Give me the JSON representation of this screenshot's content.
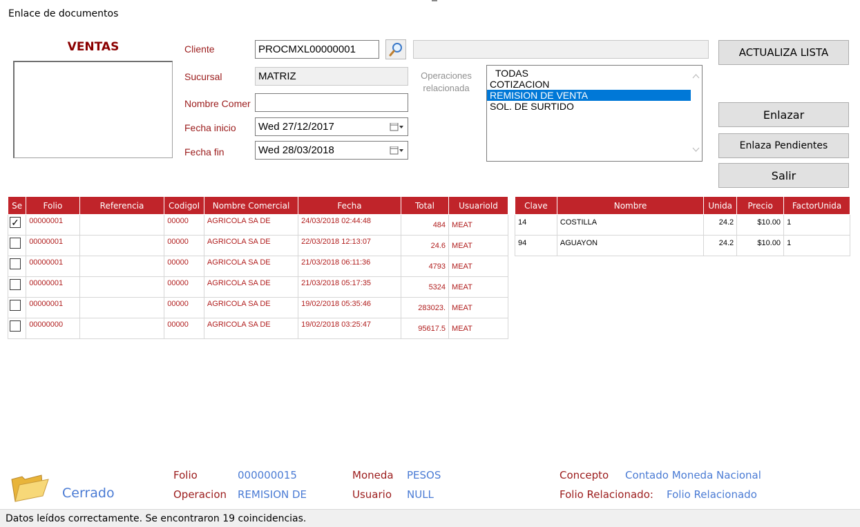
{
  "window": {
    "title": "Enlace de documentos"
  },
  "ventas": {
    "heading": "VENTAS"
  },
  "form": {
    "cliente_label": "Cliente",
    "cliente_value": "PROCMXL00000001",
    "cliente_name_value": "",
    "sucursal_label": "Sucursal",
    "sucursal_value": "MATRIZ",
    "nombre_label": "Nombre Comer",
    "nombre_value": "",
    "fecha_inicio_label": "Fecha inicio",
    "fecha_inicio_value": "Wed 27/12/2017",
    "fecha_fin_label": "Fecha fin",
    "fecha_fin_value": "Wed 28/03/2018",
    "operaciones_label_1": "Operaciones",
    "operaciones_label_2": "relacionada"
  },
  "operaciones": {
    "items": [
      "TODAS",
      "COTIZACION",
      "REMISION DE VENTA",
      "SOL. DE SURTIDO"
    ],
    "selected": "REMISION DE VENTA"
  },
  "buttons": {
    "actualiza": "ACTUALIZA LISTA",
    "enlazar": "Enlazar",
    "enlaza_pendientes": "Enlaza Pendientes",
    "salir": "Salir"
  },
  "docs_table": {
    "columns": [
      "Se",
      "Folio",
      "Referencia",
      "CodigoI",
      "Nombre Comercial",
      "Fecha",
      "Total",
      "UsuarioId"
    ],
    "rows": [
      {
        "checked": true,
        "folio": "00000001",
        "referencia": "",
        "codigo": "00000",
        "nombre": "AGRICOLA SA DE",
        "fecha": "24/03/2018 02:44:48",
        "total": "484",
        "usuario": "MEAT"
      },
      {
        "checked": false,
        "folio": "00000001",
        "referencia": "",
        "codigo": "00000",
        "nombre": "AGRICOLA SA DE",
        "fecha": "22/03/2018 12:13:07",
        "total": "24.6",
        "usuario": "MEAT"
      },
      {
        "checked": false,
        "folio": "00000001",
        "referencia": "",
        "codigo": "00000",
        "nombre": "AGRICOLA SA DE",
        "fecha": "21/03/2018 06:11:36",
        "total": "4793",
        "usuario": "MEAT"
      },
      {
        "checked": false,
        "folio": "00000001",
        "referencia": "",
        "codigo": "00000",
        "nombre": "AGRICOLA SA DE",
        "fecha": "21/03/2018 05:17:35",
        "total": "5324",
        "usuario": "MEAT"
      },
      {
        "checked": false,
        "folio": "00000001",
        "referencia": "",
        "codigo": "00000",
        "nombre": "AGRICOLA SA DE",
        "fecha": "19/02/2018 05:35:46",
        "total": "283023.",
        "usuario": "MEAT"
      },
      {
        "checked": false,
        "folio": "00000000",
        "referencia": "",
        "codigo": "00000",
        "nombre": "AGRICOLA SA DE",
        "fecha": "19/02/2018 03:25:47",
        "total": "95617.5",
        "usuario": "MEAT"
      }
    ]
  },
  "items_table": {
    "columns": [
      "Clave",
      "Nombre",
      "Unida",
      "Precio",
      "FactorUnida"
    ],
    "rows": [
      {
        "clave": "14",
        "nombre": "COSTILLA",
        "unidad": "24.2",
        "precio": "$10.00",
        "factor": "1"
      },
      {
        "clave": "94",
        "nombre": "AGUAYON",
        "unidad": "24.2",
        "precio": "$10.00",
        "factor": "1"
      }
    ]
  },
  "footer": {
    "status_label": "Cerrado",
    "folio_label": "Folio",
    "folio_value": "000000015",
    "operacion_label": "Operacion",
    "operacion_value": "REMISION DE",
    "moneda_label": "Moneda",
    "moneda_value": "PESOS",
    "usuario_label": "Usuario",
    "usuario_value": "NULL",
    "concepto_label": "Concepto",
    "concepto_value": "Contado Moneda Nacional",
    "folio_rel_label": "Folio Relacionado:",
    "folio_rel_value": "Folio Relacionado"
  },
  "statusbar": {
    "text": "Datos leídos correctamente. Se encontraron 19 coincidencias."
  },
  "colors": {
    "header_red": "#c0242a",
    "label_red": "#9b1b1b",
    "value_blue": "#4a7bd4",
    "selection_blue": "#0078d7"
  },
  "icons": {
    "search": "magnifier-icon",
    "calendar": "calendar-dropdown-icon",
    "folder": "open-folder-icon"
  }
}
